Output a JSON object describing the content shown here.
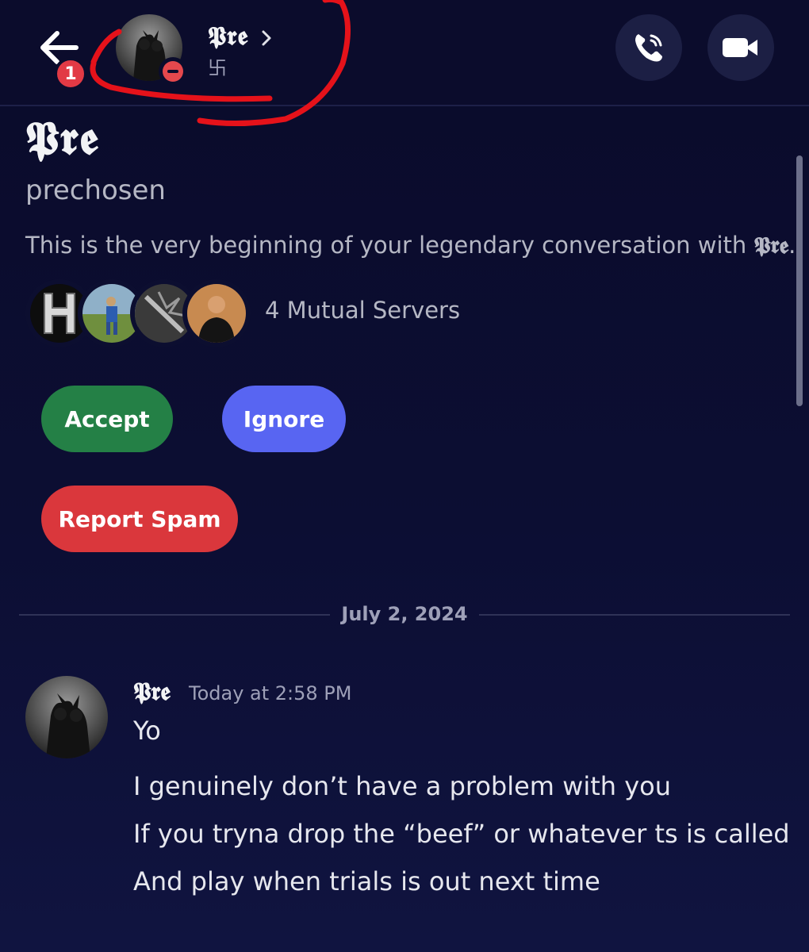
{
  "header": {
    "name": "𝕻𝖗𝖊",
    "status_symbol": "卐",
    "notification_count": "1"
  },
  "profile": {
    "display_name": "𝕻𝖗𝖊",
    "username": "prechosen",
    "intro_text": "This is the very beginning of your legendary conversation with",
    "intro_name": "𝕻𝖗𝖊",
    "intro_period": ".",
    "mutual_servers": "4 Mutual Servers"
  },
  "actions": {
    "accept": "Accept",
    "ignore": "Ignore",
    "report": "Report Spam"
  },
  "divider": {
    "date": "July 2, 2024"
  },
  "message": {
    "author": "𝕻𝖗𝖊",
    "timestamp": "Today at 2:58 PM",
    "lines": [
      "Yo",
      "I genuinely don’t have a problem with you",
      "If you tryna drop the “beef” or whatever ts is called",
      "And play when trials is out next time"
    ]
  },
  "colors": {
    "background": "#0c0e33",
    "accept": "#248046",
    "ignore": "#5865f2",
    "report": "#da373c",
    "dnd": "#e5484d",
    "annotation": "#e5121a"
  },
  "icons": [
    "back-arrow-icon",
    "phone-icon",
    "video-camera-icon",
    "dnd-status-icon",
    "chevron-right-icon"
  ]
}
